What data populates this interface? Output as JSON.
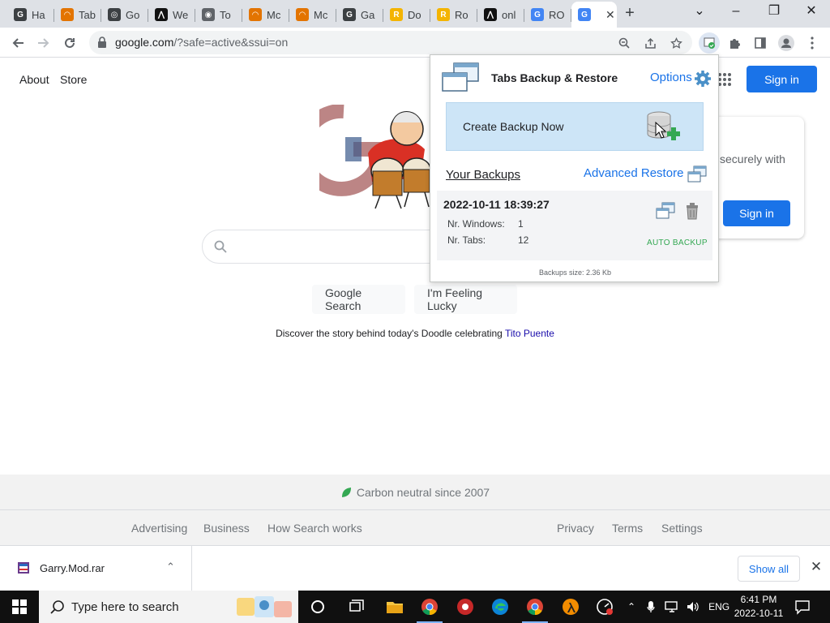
{
  "tabs": [
    {
      "label": "Ha",
      "fav_color": "#3c4043",
      "fav_glyph": "G"
    },
    {
      "label": "Tab",
      "fav_color": "#e37400",
      "fav_glyph": "◠"
    },
    {
      "label": "Go",
      "fav_color": "#3c4043",
      "fav_glyph": "◎"
    },
    {
      "label": "We",
      "fav_color": "#111111",
      "fav_glyph": "⋀"
    },
    {
      "label": "To",
      "fav_color": "#5f6368",
      "fav_glyph": "◉"
    },
    {
      "label": "Mc",
      "fav_color": "#e37400",
      "fav_glyph": "◠"
    },
    {
      "label": "Mc",
      "fav_color": "#e37400",
      "fav_glyph": "◠"
    },
    {
      "label": "Ga",
      "fav_color": "#3c4043",
      "fav_glyph": "G"
    },
    {
      "label": "Do",
      "fav_color": "#f4b400",
      "fav_glyph": "R"
    },
    {
      "label": "Ro",
      "fav_color": "#f4b400",
      "fav_glyph": "R"
    },
    {
      "label": "onl",
      "fav_color": "#111111",
      "fav_glyph": "⋀"
    },
    {
      "label": "RO",
      "fav_color": "#4285f4",
      "fav_glyph": "G"
    },
    {
      "label": "",
      "fav_color": "#4285f4",
      "fav_glyph": "G",
      "active": true
    }
  ],
  "toolbar": {
    "url_host": "google.com",
    "url_rest": "/?safe=active&ssui=on"
  },
  "page": {
    "about": "About",
    "store": "Store",
    "signin": "Sign in",
    "google_search": "Google Search",
    "feeling_lucky": "I'm Feeling Lucky",
    "discover_prefix": "Discover the story behind today's Doodle celebrating ",
    "discover_link": "Tito Puente",
    "signin_card_text": "securely with",
    "signin_card_button": "Sign in",
    "carbon": "Carbon neutral since 2007",
    "footer_left": [
      "Advertising",
      "Business",
      "How Search works"
    ],
    "footer_right": [
      "Privacy",
      "Terms",
      "Settings"
    ]
  },
  "popup": {
    "title": "Tabs Backup & Restore",
    "options": "Options",
    "create_backup": "Create Backup Now",
    "your_backups": "Your Backups",
    "advanced_restore": "Advanced Restore",
    "backup_date": "2022-10-11 18:39:27",
    "windows_label": "Nr. Windows:",
    "windows_value": "1",
    "tabs_label": "Nr. Tabs:",
    "tabs_value": "12",
    "auto_backup": "AUTO BACKUP",
    "backups_size": "Backups size: 2.36 Kb"
  },
  "download": {
    "filename": "Garry.Mod.rar",
    "show_all": "Show all"
  },
  "taskbar": {
    "search_placeholder": "Type here to search",
    "lang": "ENG",
    "time": "6:41 PM",
    "date": "2022-10-11"
  },
  "colors": {
    "accent": "#1a73e8",
    "popup_button": "#cde5f7",
    "auto_backup": "#34a853"
  }
}
